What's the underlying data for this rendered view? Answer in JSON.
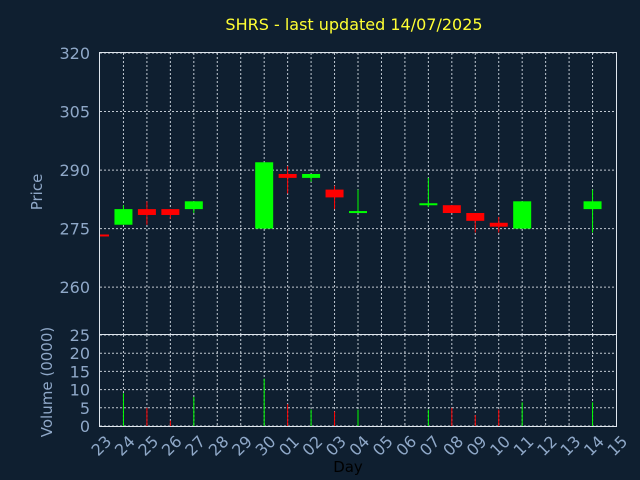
{
  "title": "SHRS - last updated 14/07/2025",
  "colors": {
    "background": "#0f1f30",
    "up": "#00ff00",
    "down": "#ff0000",
    "title": "#ffff33",
    "axis_text": "#8fa8c8",
    "grid": "#dfe6ee"
  },
  "chart_data": [
    {
      "type": "candlestick",
      "ylabel": "Price",
      "ylim": [
        248,
        320
      ],
      "yticks": [
        260,
        275,
        290,
        305,
        320
      ],
      "grid": true,
      "x": [
        "23",
        "24",
        "25",
        "26",
        "27",
        "28",
        "29",
        "30",
        "01",
        "02",
        "03",
        "04",
        "05",
        "06",
        "07",
        "08",
        "09",
        "10",
        "11",
        "12",
        "13",
        "14",
        "15"
      ],
      "candles": [
        {
          "x": "23",
          "open": 273.5,
          "close": 273.0,
          "high": 273.5,
          "low": 273.0
        },
        {
          "x": "24",
          "open": 276.0,
          "close": 280.0,
          "high": 281.0,
          "low": 276.0
        },
        {
          "x": "25",
          "open": 280.0,
          "close": 278.5,
          "high": 282.0,
          "low": 276.0
        },
        {
          "x": "26",
          "open": 280.0,
          "close": 278.5,
          "high": 280.0,
          "low": 277.5
        },
        {
          "x": "27",
          "open": 280.0,
          "close": 282.0,
          "high": 282.0,
          "low": 279.0
        },
        {
          "x": "30",
          "open": 275.0,
          "close": 292.0,
          "high": 292.0,
          "low": 275.0
        },
        {
          "x": "01",
          "open": 289.0,
          "close": 288.0,
          "high": 291.0,
          "low": 284.0
        },
        {
          "x": "02",
          "open": 288.0,
          "close": 289.0,
          "high": 289.0,
          "low": 287.0
        },
        {
          "x": "03",
          "open": 285.0,
          "close": 283.0,
          "high": 286.0,
          "low": 280.0
        },
        {
          "x": "04",
          "open": 279.0,
          "close": 279.5,
          "high": 285.0,
          "low": 279.0
        },
        {
          "x": "07",
          "open": 281.0,
          "close": 281.5,
          "high": 288.0,
          "low": 280.5
        },
        {
          "x": "08",
          "open": 281.0,
          "close": 279.0,
          "high": 281.0,
          "low": 279.0
        },
        {
          "x": "09",
          "open": 279.0,
          "close": 277.0,
          "high": 279.0,
          "low": 274.0
        },
        {
          "x": "10",
          "open": 276.5,
          "close": 275.5,
          "high": 278.0,
          "low": 274.0
        },
        {
          "x": "11",
          "open": 275.0,
          "close": 282.0,
          "high": 282.0,
          "low": 275.0
        },
        {
          "x": "14",
          "open": 280.0,
          "close": 282.0,
          "high": 285.0,
          "low": 274.0
        }
      ]
    },
    {
      "type": "bar",
      "ylabel": "Volume (0000)",
      "xlabel": "Day",
      "ylim": [
        0,
        25
      ],
      "yticks": [
        0,
        5,
        10,
        15,
        20,
        25
      ],
      "grid": true,
      "bars": [
        {
          "x": "24",
          "value": 9,
          "direction": "up"
        },
        {
          "x": "25",
          "value": 5,
          "direction": "down"
        },
        {
          "x": "26",
          "value": 1.5,
          "direction": "down"
        },
        {
          "x": "27",
          "value": 8,
          "direction": "up"
        },
        {
          "x": "30",
          "value": 13,
          "direction": "up"
        },
        {
          "x": "01",
          "value": 6,
          "direction": "down"
        },
        {
          "x": "02",
          "value": 4.5,
          "direction": "up"
        },
        {
          "x": "03",
          "value": 4,
          "direction": "down"
        },
        {
          "x": "04",
          "value": 4.5,
          "direction": "up"
        },
        {
          "x": "07",
          "value": 4.5,
          "direction": "up"
        },
        {
          "x": "08",
          "value": 5,
          "direction": "down"
        },
        {
          "x": "09",
          "value": 3,
          "direction": "down"
        },
        {
          "x": "10",
          "value": 4.5,
          "direction": "down"
        },
        {
          "x": "11",
          "value": 6.5,
          "direction": "up"
        },
        {
          "x": "14",
          "value": 6.5,
          "direction": "up"
        }
      ]
    }
  ]
}
